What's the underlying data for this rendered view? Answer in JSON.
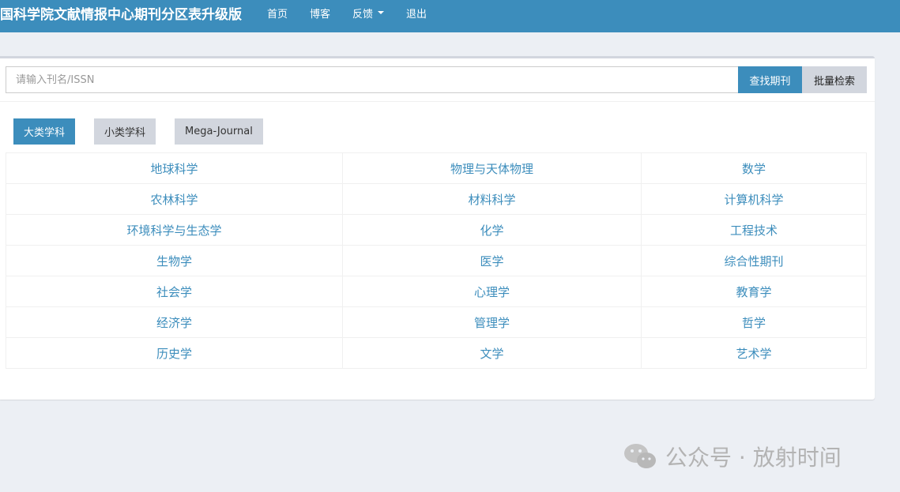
{
  "header": {
    "brand": "国科学院文献情报中心期刊分区表升级版",
    "nav": [
      {
        "label": "首页"
      },
      {
        "label": "博客"
      },
      {
        "label": "反馈"
      },
      {
        "label": "退出"
      }
    ]
  },
  "search": {
    "placeholder": "请输入刊名/ISSN",
    "value": "",
    "find_label": "查找期刊",
    "batch_label": "批量检索"
  },
  "tabs": [
    {
      "label": "大类学科",
      "active": true
    },
    {
      "label": "小类学科",
      "active": false
    },
    {
      "label": "Mega-Journal",
      "active": false
    }
  ],
  "subjects": [
    [
      "地球科学",
      "物理与天体物理",
      "数学"
    ],
    [
      "农林科学",
      "材料科学",
      "计算机科学"
    ],
    [
      "环境科学与生态学",
      "化学",
      "工程技术"
    ],
    [
      "生物学",
      "医学",
      "综合性期刊"
    ],
    [
      "社会学",
      "心理学",
      "教育学"
    ],
    [
      "经济学",
      "管理学",
      "哲学"
    ],
    [
      "历史学",
      "文学",
      "艺术学"
    ]
  ],
  "watermark": {
    "icon": "wechat-icon",
    "text": "公众号 · 放射时间"
  },
  "colors": {
    "primary": "#3c8dbc",
    "background": "#eceff4",
    "secondary_button": "#d2d6de"
  }
}
